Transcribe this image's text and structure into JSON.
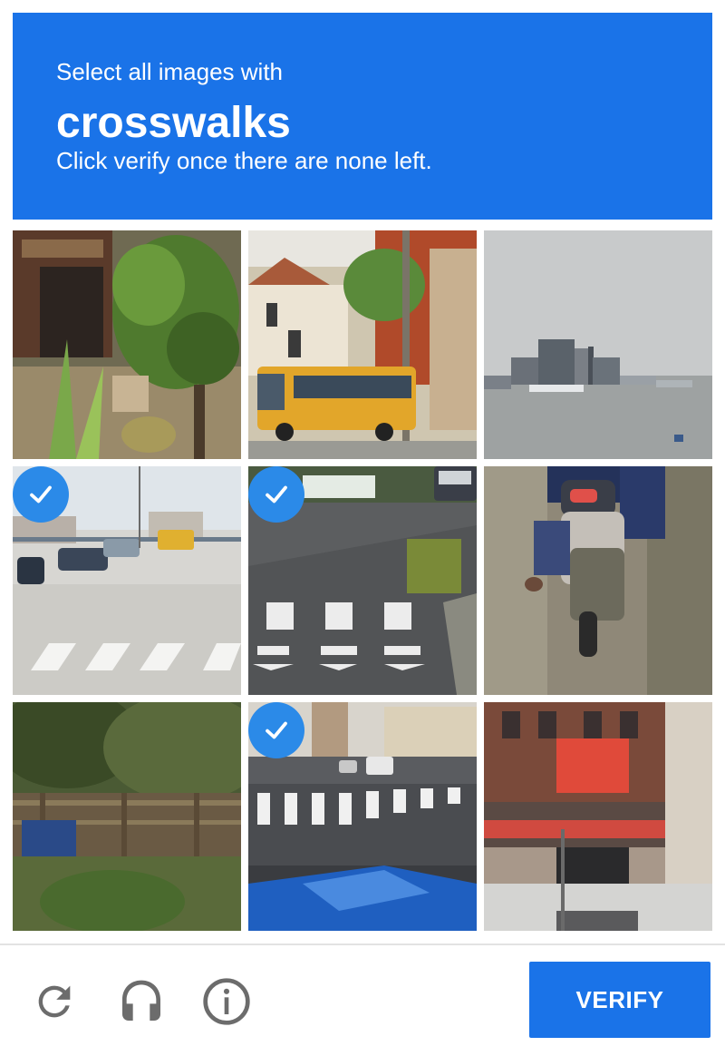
{
  "header": {
    "instruction": "Select all images with",
    "target": "crosswalks",
    "hint": "Click verify once there are none left."
  },
  "tiles": [
    {
      "scene": "house-with-plants",
      "selected": false
    },
    {
      "scene": "yellow-bus-street",
      "selected": false
    },
    {
      "scene": "harbor-skyline",
      "selected": false
    },
    {
      "scene": "street-crosswalk-cars",
      "selected": true
    },
    {
      "scene": "road-crosswalk",
      "selected": true
    },
    {
      "scene": "motorcycle-rear",
      "selected": false
    },
    {
      "scene": "wooden-shack-trees",
      "selected": false
    },
    {
      "scene": "city-crosswalk",
      "selected": true
    },
    {
      "scene": "storefront-building",
      "selected": false
    }
  ],
  "footer": {
    "reload_icon": "reload-icon",
    "audio_icon": "headphones-icon",
    "info_icon": "info-icon",
    "verify_label": "VERIFY"
  },
  "colors": {
    "accent": "#1a73e8",
    "check": "#2b8ae8"
  }
}
